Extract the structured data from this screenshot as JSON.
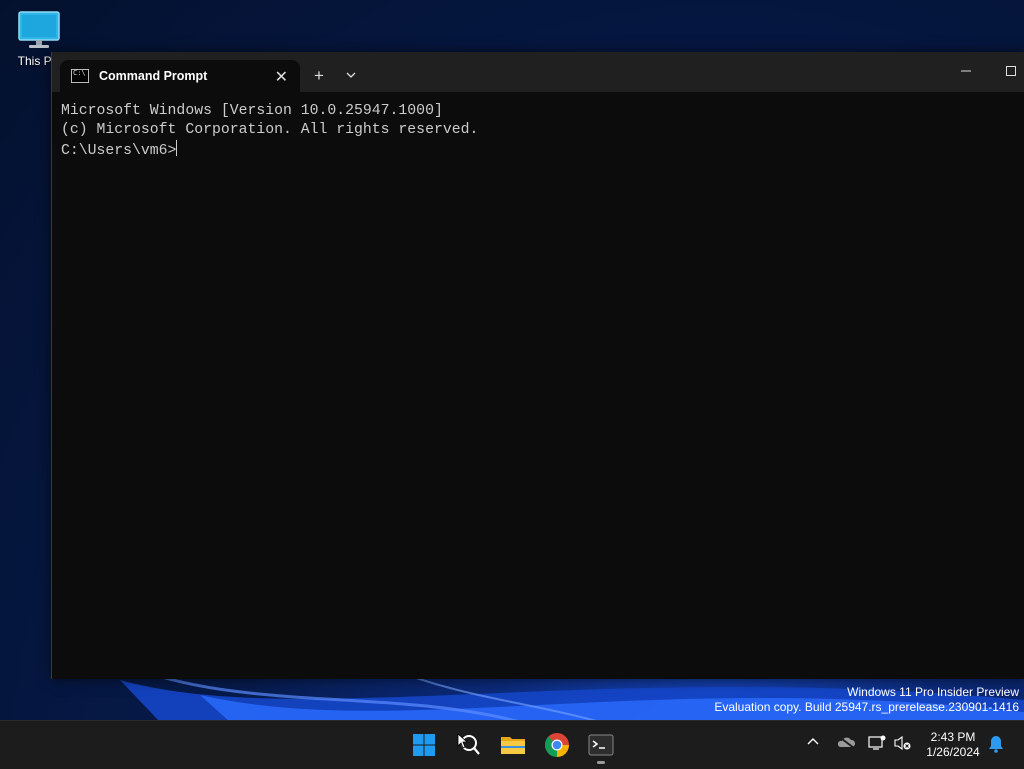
{
  "desktop": {
    "icon_label": "This PC"
  },
  "window": {
    "tab_title": "Command Prompt",
    "tab_icon_text": "C:\\",
    "new_tab_glyph": "+",
    "close_glyph": "✕"
  },
  "terminal": {
    "line1": "Microsoft Windows [Version 10.0.25947.1000]",
    "line2": "(c) Microsoft Corporation. All rights reserved.",
    "line3": "",
    "prompt": "C:\\Users\\vm6>"
  },
  "watermark": {
    "line1": "Windows 11 Pro Insider Preview",
    "line2": "Evaluation copy. Build 25947.rs_prerelease.230901-1416"
  },
  "taskbar": {
    "items": [
      "start-icon",
      "search-icon",
      "file-explorer-icon",
      "chrome-icon",
      "terminal-icon"
    ],
    "tray_chevron": "^",
    "time": "2:43 PM",
    "date": "1/26/2024"
  },
  "colors": {
    "terminal_bg": "#0c0c0c",
    "terminal_fg": "#cccccc",
    "titlebar": "#202020",
    "taskbar": "#1c1c1c",
    "accent": "#0078d4"
  }
}
